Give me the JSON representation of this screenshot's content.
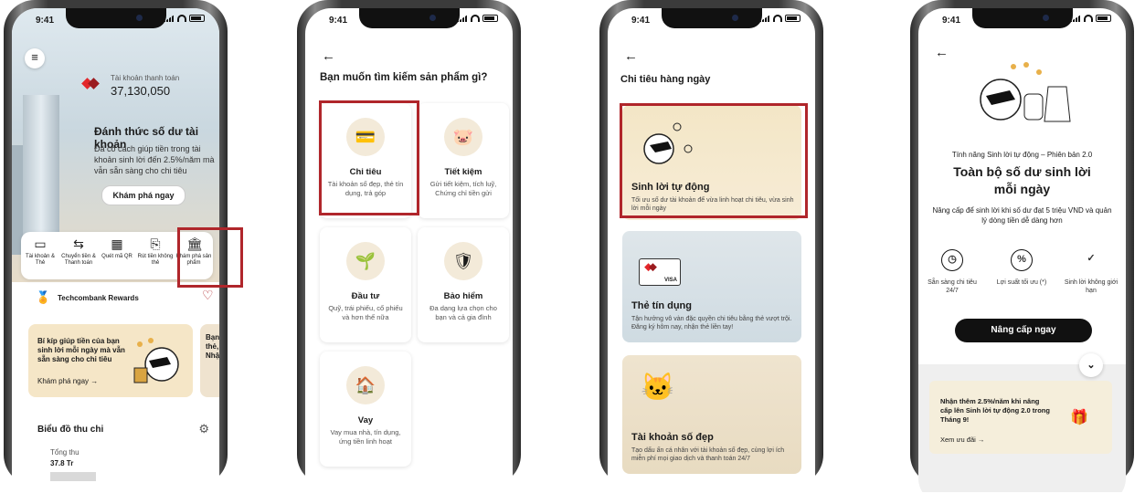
{
  "status_time": "9:41",
  "phone1": {
    "account_label": "Tài khoản thanh toán",
    "account_balance": "37,130,050",
    "wake_title": "Đánh thức số dư tài khoản",
    "wake_body": "Đã có cách giúp tiền trong tài khoản sinh lời đến 2.5%/năm mà vẫn sẵn sàng cho chi tiêu",
    "explore_button": "Khám phá ngay",
    "quick_actions": [
      {
        "label": "Tài khoản & Thẻ",
        "icon": "card-icon"
      },
      {
        "label": "Chuyển tiền & Thanh toán",
        "icon": "transfer-icon"
      },
      {
        "label": "Quét mã QR",
        "icon": "qr-icon"
      },
      {
        "label": "Rút tiền không thẻ",
        "icon": "atm-icon"
      },
      {
        "label": "Khám phá sản phẩm",
        "icon": "bank-icon"
      }
    ],
    "rewards_label": "Techcombank Rewards",
    "promo_text": "Bí kíp giúp tiền của bạn sinh lời mỗi ngày mà vẫn sẵn sàng cho chi tiêu",
    "promo_link": "Khám phá ngay →",
    "promo2_text": "Bạn thẻ, Nhậ",
    "chart_title": "Biểu đồ thu chi",
    "chart_sub": "Tổng thu",
    "chart_value": "37.8 Tr"
  },
  "phone2": {
    "title": "Bạn muốn tìm kiếm sản phẩm gì?",
    "categories": [
      {
        "label": "Chi tiêu",
        "desc": "Tài khoản số đẹp, thẻ tín dụng, trả góp",
        "icon": "card-icon"
      },
      {
        "label": "Tiết kiệm",
        "desc": "Gửi tiết kiệm, tích luỹ, Chứng chỉ tiền gửi",
        "icon": "piggy-bank-icon"
      },
      {
        "label": "Đầu tư",
        "desc": "Quỹ, trái phiếu, cổ phiếu và hơn thế nữa",
        "icon": "plant-coin-icon"
      },
      {
        "label": "Bảo hiểm",
        "desc": "Đa dạng lựa chọn cho bạn và cả gia đình",
        "icon": "shield-icon"
      },
      {
        "label": "Vay",
        "desc": "Vay mua nhà, tín dụng, ứng tiền linh hoạt",
        "icon": "house-icon"
      }
    ]
  },
  "phone3": {
    "title": "Chi tiêu hàng ngày",
    "cards": [
      {
        "title": "Sinh lời tự động",
        "desc": "Tối ưu số dư tài khoản để vừa linh hoạt chi tiêu, vừa sinh lời mỗi ngày"
      },
      {
        "title": "Thẻ tín dụng",
        "desc": "Tận hưởng vô vàn đặc quyền chi tiêu bằng thẻ vượt trội. Đăng ký hôm nay, nhận thẻ liền tay!",
        "badge": "VISA"
      },
      {
        "title": "Tài khoản số đẹp",
        "desc": "Tạo dấu ấn cá nhân với tài khoản số đẹp, cùng lợi ích miễn phí mọi giao dịch và thanh toán 24/7"
      }
    ]
  },
  "phone4": {
    "feature_label": "Tính năng Sinh lời tự động – Phiên bản 2.0",
    "headline": "Toàn bộ số dư sinh lời mỗi ngày",
    "desc": "Nâng cấp để sinh lời khi số dư đạt 5 triệu VND và quản lý dòng tiền dễ dàng hơn",
    "benefits": [
      {
        "label": "Sẵn sàng chi tiêu 24/7",
        "icon": "clock-icon"
      },
      {
        "label": "Lợi suất tối ưu (*)",
        "icon": "percent-icon"
      },
      {
        "label": "Sinh lời không giới hạn",
        "icon": "hand-coin-icon"
      }
    ],
    "upgrade_button": "Nâng cấp ngay",
    "offer_text": "Nhận thêm 2.5%/năm khi nâng cấp lên Sinh lời tự động 2.0 trong Tháng 9!",
    "offer_link": "Xem ưu đãi →"
  },
  "colors": {
    "highlight": "#b0262b",
    "brand_red": "#e3262a"
  }
}
